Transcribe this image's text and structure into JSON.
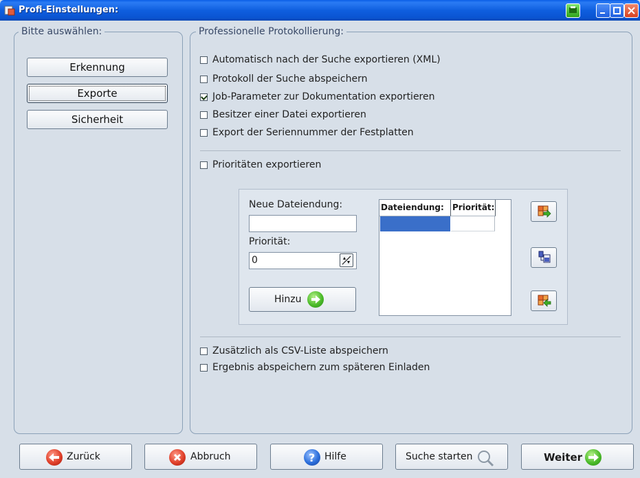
{
  "window": {
    "title": "Profi-Einstellungen:"
  },
  "left_panel": {
    "title": "Bitte auswählen:",
    "buttons": [
      {
        "label": "Erkennung",
        "active": false
      },
      {
        "label": "Exporte",
        "active": true
      },
      {
        "label": "Sicherheit",
        "active": false
      }
    ]
  },
  "right_panel": {
    "title": "Professionelle Protokollierung:",
    "options": [
      {
        "label": "Automatisch nach der Suche exportieren (XML)",
        "checked": false
      },
      {
        "label": "Protokoll der Suche abspeichern",
        "checked": false
      },
      {
        "label": "Job-Parameter zur Dokumentation exportieren",
        "checked": true
      },
      {
        "label": "Besitzer einer Datei exportieren",
        "checked": false
      },
      {
        "label": "Export der Seriennummer der Festplatten",
        "checked": false
      }
    ],
    "priorities": {
      "label": "Prioritäten exportieren",
      "checked": false
    },
    "priority_box": {
      "new_ext_label": "Neue Dateiendung:",
      "new_ext_value": "",
      "priority_label": "Priorität:",
      "priority_value": "0",
      "add_label": "Hinzu",
      "table_headers": [
        "Dateiendung:",
        "Priorität:"
      ]
    },
    "bottom_options": [
      {
        "label": "Zusätzlich als CSV-Liste abspeichern",
        "checked": false
      },
      {
        "label": "Ergebnis abspeichern zum späteren Einladen",
        "checked": false
      }
    ]
  },
  "footer": {
    "back": "Zurück",
    "cancel": "Abbruch",
    "help": "Hilfe",
    "search": "Suche starten",
    "next": "Weiter"
  },
  "colors": {
    "accent": "#3a6fc9",
    "titlebar": "#0a5ee6",
    "background": "#d7dfe8"
  }
}
